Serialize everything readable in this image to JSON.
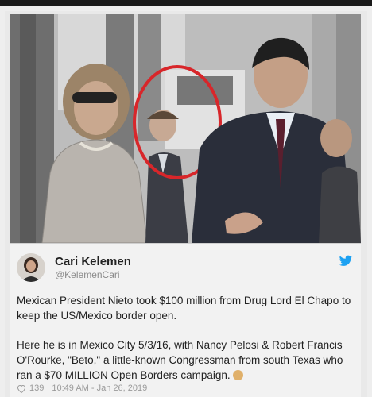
{
  "tweet": {
    "name": "Cari Kelemen",
    "handle": "@KelemenCari",
    "paragraph1": "Mexican President Nieto took $100 million from Drug Lord El Chapo to keep the US/Mexico border open.",
    "paragraph2": "Here he is in Mexico City 5/3/16, with Nancy Pelosi & Robert Francis O'Rourke, \"Beto,\" a little-known Congressman from south Texas who ran a  $70 MILLION Open Borders campaign.",
    "likes": "139",
    "timestamp": "10:49 AM - Jan 26, 2019"
  },
  "colors": {
    "circle": "#d8262a",
    "twitter_blue": "#1da1f2"
  },
  "icons": {
    "twitter": "twitter-bird-icon",
    "like": "heart-icon",
    "emoji": "emoji-icon"
  }
}
